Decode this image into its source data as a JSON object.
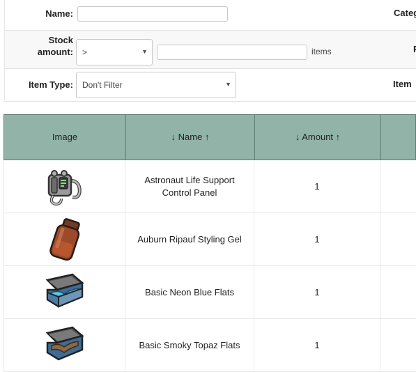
{
  "filters": {
    "name_label": "Name:",
    "name_value": "",
    "category_label": "Categ",
    "stock_label_line1": "Stock",
    "stock_label_line2": "amount:",
    "stock_operator": ">",
    "stock_value": "",
    "stock_suffix": "items",
    "right_label_2": "P",
    "item_type_label": "Item Type:",
    "item_type_value": "Don't Filter",
    "right_label_3": "Item"
  },
  "table": {
    "headers": [
      "Image",
      "↓ Name ↑",
      "↓ Amount ↑",
      ""
    ],
    "rows": [
      {
        "icon": "life-support-panel-icon",
        "name": "Astronaut Life Support Control Panel",
        "amount": "1"
      },
      {
        "icon": "styling-gel-bottle-icon",
        "name": "Auburn Ripauf Styling Gel",
        "amount": "1"
      },
      {
        "icon": "blue-flats-box-icon",
        "name": "Basic Neon Blue Flats",
        "amount": "1"
      },
      {
        "icon": "topaz-flats-box-icon",
        "name": "Basic Smoky Topaz Flats",
        "amount": "1"
      }
    ]
  }
}
